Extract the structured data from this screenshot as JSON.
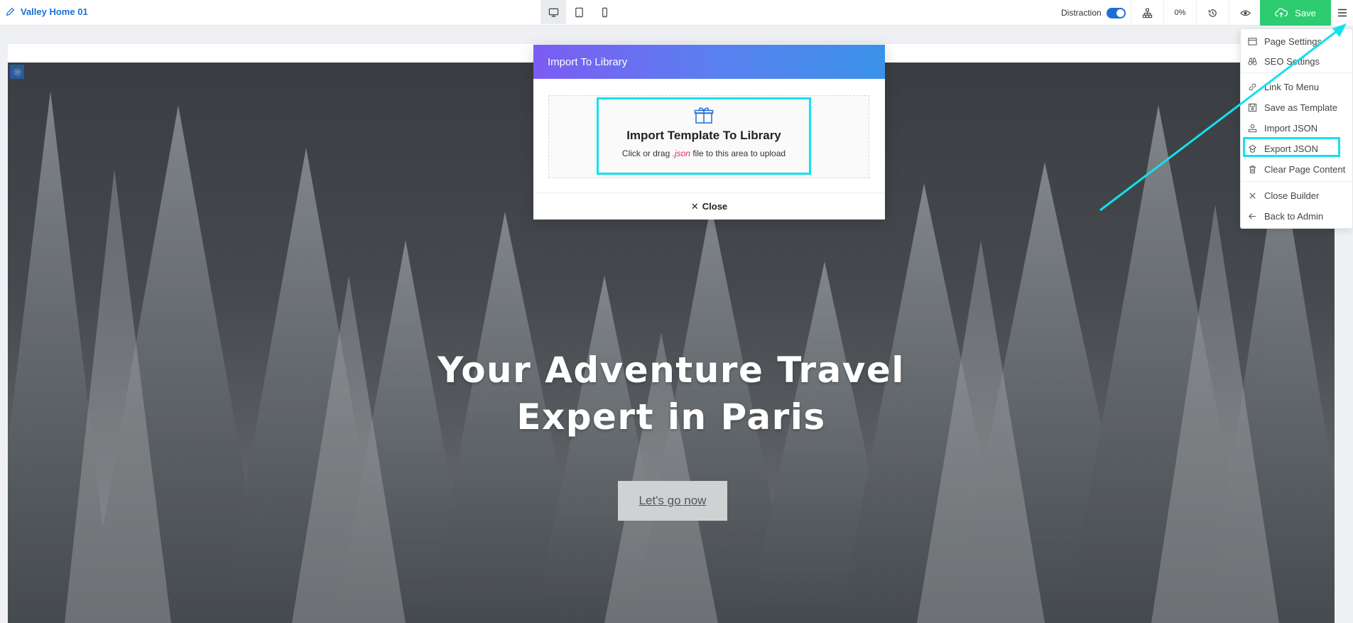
{
  "header": {
    "page_name": "Valley Home 01",
    "distraction_label": "Distraction",
    "progress_label": "0%",
    "save_label": "Save"
  },
  "devices": [
    "desktop-icon",
    "tablet-icon",
    "mobile-icon"
  ],
  "modal": {
    "title": "Import To Library",
    "drop_title": "Import Template To Library",
    "drop_sub_before": "Click or drag",
    "drop_sub_ext": ".json",
    "drop_sub_after": "file to this area to upload",
    "close_label": "Close"
  },
  "hero": {
    "title_line1": "Your Adventure Travel",
    "title_line2": "Expert in Paris",
    "cta": "Let's go now"
  },
  "menu": {
    "items": [
      {
        "label": "Page Settings",
        "icon": "page-settings-icon"
      },
      {
        "label": "SEO Settings",
        "icon": "binoculars-icon"
      },
      {
        "label": "Link To Menu",
        "icon": "link-icon"
      },
      {
        "label": "Save as Template",
        "icon": "save-template-icon"
      },
      {
        "label": "Import JSON",
        "icon": "import-icon"
      },
      {
        "label": "Export JSON",
        "icon": "export-icon"
      },
      {
        "label": "Clear Page Content",
        "icon": "trash-icon"
      },
      {
        "label": "Close Builder",
        "icon": "close-icon"
      },
      {
        "label": "Back to Admin",
        "icon": "arrow-left-icon"
      }
    ]
  },
  "colors": {
    "accent": "#1c6fd6",
    "save": "#2ecc71",
    "highlight": "#13e1ee",
    "modal_gradient_start": "#7c5cf2",
    "modal_gradient_end": "#3a92e8"
  }
}
